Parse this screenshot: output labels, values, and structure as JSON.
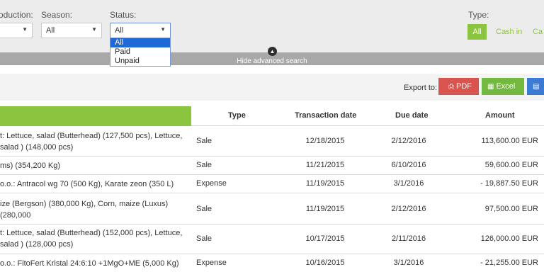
{
  "filters": {
    "production_label": "oduction:",
    "season_label": "Season:",
    "season_value": "All",
    "status_label": "Status:",
    "status_value": "All",
    "status_options": [
      "All",
      "Paid",
      "Unpaid"
    ],
    "type_label": "Type:",
    "type_buttons": [
      "All",
      "Cash in",
      "Ca"
    ]
  },
  "hide_search": "Hide advanced search",
  "export": {
    "label": "Export to:",
    "pdf": "PDF",
    "excel": "Excel"
  },
  "table": {
    "headers": [
      "Type",
      "Transaction date",
      "Due date",
      "Amount"
    ],
    "rows": [
      {
        "description": "t: Lettuce, salad (Butterhead) (127,500 pcs), Lettuce, salad ) (148,000 pcs)",
        "type": "Sale",
        "transaction_date": "12/18/2015",
        "due_date": "2/12/2016",
        "amount": "113,600.00 EUR"
      },
      {
        "description": "ms) (354,200 Kg)",
        "type": "Sale",
        "transaction_date": "11/21/2015",
        "due_date": "6/10/2016",
        "amount": "59,600.00 EUR"
      },
      {
        "description": "o.o.: Antracol wg 70 (500 Kg), Karate zeon (350 L)",
        "type": "Expense",
        "transaction_date": "11/19/2015",
        "due_date": "3/1/2016",
        "amount": "- 19,887.50 EUR"
      },
      {
        "description": "ize (Bergson) (380,000 Kg), Corn, maize (Luxus) (280,000",
        "type": "Sale",
        "transaction_date": "11/19/2015",
        "due_date": "2/12/2016",
        "amount": "97,500.00 EUR"
      },
      {
        "description": "t: Lettuce, salad (Butterhead) (152,000 pcs), Lettuce, salad ) (128,000 pcs)",
        "type": "Sale",
        "transaction_date": "10/17/2015",
        "due_date": "2/11/2016",
        "amount": "126,000.00 EUR"
      },
      {
        "description": "o.o.: FitoFert Kristal 24:6:10 +1MgO+ME (5,000 Kg)",
        "type": "Expense",
        "transaction_date": "10/16/2015",
        "due_date": "3/1/2016",
        "amount": "- 21,255.00 EUR"
      }
    ]
  }
}
